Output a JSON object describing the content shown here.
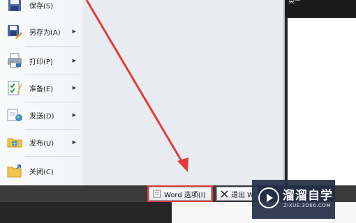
{
  "menu": {
    "items": [
      {
        "label": "保存(S)",
        "icon": "floppy-disk-icon",
        "has_submenu": false
      },
      {
        "label": "另存为(A)",
        "icon": "save-as-icon",
        "has_submenu": true
      },
      {
        "label": "打印(P)",
        "icon": "printer-icon",
        "has_submenu": true
      },
      {
        "label": "准备(E)",
        "icon": "prepare-document-icon",
        "has_submenu": true
      },
      {
        "label": "发送(D)",
        "icon": "send-icon",
        "has_submenu": true
      },
      {
        "label": "发布(U)",
        "icon": "publish-folder-icon",
        "has_submenu": true
      },
      {
        "label": "关闭(C)",
        "icon": "close-folder-icon",
        "has_submenu": false
      }
    ],
    "submenu_arrow": "▶"
  },
  "titlebar": {
    "text": "莫ᅳ"
  },
  "buttons": {
    "word_options": "Word 选项(I)",
    "exit": "退出 W"
  },
  "watermark": {
    "title": "溜溜自学",
    "url": "ZIXUE.3D66.COM"
  },
  "colors": {
    "annotation_red": "#e23a3a",
    "watermark_bg": "#232f48"
  }
}
